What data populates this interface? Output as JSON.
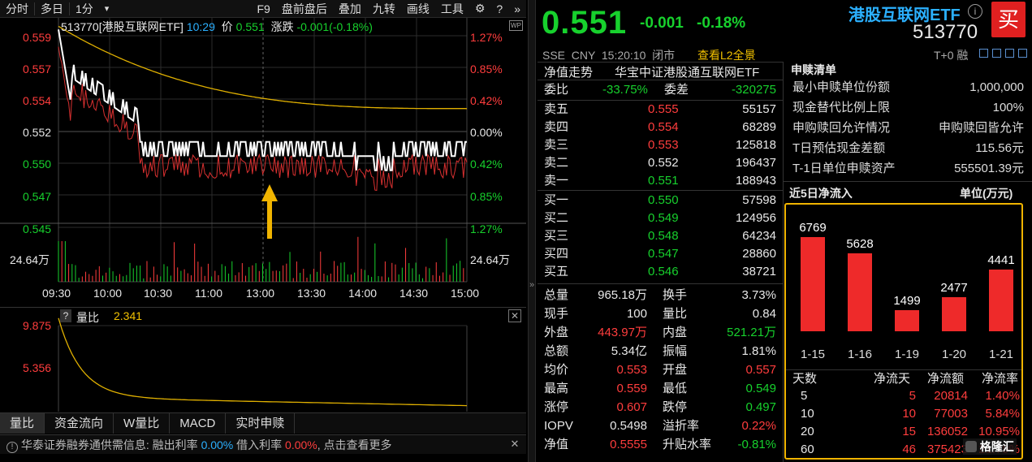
{
  "toolbar": {
    "items": [
      "分时",
      "多日",
      "1分",
      "▾",
      "F9",
      "盘前盘后",
      "叠加",
      "九转",
      "画线",
      "工具"
    ]
  },
  "chart": {
    "header_code": "513770[港股互联网ETF]",
    "header_time": "10:29",
    "header_price_label": "价",
    "header_price": "0.551",
    "header_change_label": "涨跌",
    "header_change": "-0.001(-0.18%)",
    "y_left": [
      "0.559",
      "0.557",
      "0.554",
      "0.552",
      "0.550",
      "0.547",
      "0.545"
    ],
    "y_right": [
      "1.27%",
      "0.85%",
      "0.42%",
      "0.00%",
      "0.42%",
      "0.85%",
      "1.27%"
    ],
    "vol_left": "24.64万",
    "vol_right": "24.64万",
    "x_labels": [
      "09:30",
      "10:00",
      "10:30",
      "11:00",
      "13:00",
      "13:30",
      "14:00",
      "14:30",
      "15:00"
    ],
    "colors": {
      "price": "#ffffff",
      "avg": "#e0b000",
      "nav": "#e03a3a",
      "up": "#ff3d3d",
      "down": "#17d12d"
    }
  },
  "volratio": {
    "title": "量比",
    "value": "2.341",
    "y_labels": [
      "9.875",
      "5.356"
    ]
  },
  "bottom_tabs": [
    "量比",
    "资金流向",
    "W量比",
    "MACD",
    "实时申赎"
  ],
  "ticker_bar": {
    "prefix": "华泰证券融券通供需信息:",
    "l1": "融出利率",
    "v1": "0.00%",
    "l2": "借入利率",
    "v2": "0.00%",
    "suffix": "点击查看更多"
  },
  "quote": {
    "price": "0.551",
    "change": "-0.001",
    "change_pct": "-0.18%",
    "name": "港股互联网ETF",
    "code": "513770",
    "buy_button": "买",
    "meta": "SSE  CNY  15:20:10  闭市",
    "l2_link": "查看L2全景",
    "t0": "T+0 融",
    "nav_trend": "净值走势",
    "index_name": "华宝中证港股通互联网ETF",
    "weibi_label": "委比",
    "weibi": "-33.75%",
    "weicha_label": "委差",
    "weicha": "-320275"
  },
  "order_book": {
    "asks": [
      {
        "label": "卖五",
        "price": "0.555",
        "vol": "55157",
        "color": "red"
      },
      {
        "label": "卖四",
        "price": "0.554",
        "vol": "68289",
        "color": "red"
      },
      {
        "label": "卖三",
        "price": "0.553",
        "vol": "125818",
        "color": "red"
      },
      {
        "label": "卖二",
        "price": "0.552",
        "vol": "196437",
        "color": "white"
      },
      {
        "label": "卖一",
        "price": "0.551",
        "vol": "188943",
        "color": "green"
      }
    ],
    "bids": [
      {
        "label": "买一",
        "price": "0.550",
        "vol": "57598",
        "color": "green"
      },
      {
        "label": "买二",
        "price": "0.549",
        "vol": "124956",
        "color": "green"
      },
      {
        "label": "买三",
        "price": "0.548",
        "vol": "64234",
        "color": "green"
      },
      {
        "label": "买四",
        "price": "0.547",
        "vol": "28860",
        "color": "green"
      },
      {
        "label": "买五",
        "price": "0.546",
        "vol": "38721",
        "color": "green"
      }
    ]
  },
  "stats": [
    {
      "l1": "总量",
      "v1": "965.18万",
      "c1": "white",
      "l2": "换手",
      "v2": "3.73%",
      "c2": "white"
    },
    {
      "l1": "现手",
      "v1": "100",
      "c1": "white",
      "l2": "量比",
      "v2": "0.84",
      "c2": "white"
    },
    {
      "l1": "外盘",
      "v1": "443.97万",
      "c1": "red",
      "l2": "内盘",
      "v2": "521.21万",
      "c2": "green"
    },
    {
      "l1": "总额",
      "v1": "5.34亿",
      "c1": "white",
      "l2": "振幅",
      "v2": "1.81%",
      "c2": "white"
    },
    {
      "l1": "均价",
      "v1": "0.553",
      "c1": "red",
      "l2": "开盘",
      "v2": "0.557",
      "c2": "red"
    },
    {
      "l1": "最高",
      "v1": "0.559",
      "c1": "red",
      "l2": "最低",
      "v2": "0.549",
      "c2": "green"
    },
    {
      "l1": "涨停",
      "v1": "0.607",
      "c1": "red",
      "l2": "跌停",
      "v2": "0.497",
      "c2": "green"
    },
    {
      "l1": "IOPV",
      "v1": "0.5498",
      "c1": "white",
      "l2": "溢折率",
      "v2": "0.22%",
      "c2": "red"
    },
    {
      "l1": "净值",
      "v1": "0.5555",
      "c1": "red",
      "l2": "升贴水率",
      "v2": "-0.81%",
      "c2": "green"
    }
  ],
  "creation": {
    "title": "申赎清单",
    "rows": [
      {
        "k": "最小申赎单位份额",
        "v": "1,000,000"
      },
      {
        "k": "现金替代比例上限",
        "v": "100%"
      },
      {
        "k": "申购赎回允许情况",
        "v": "申购赎回皆允许"
      },
      {
        "k": "T日预估现金差额",
        "v": "115.56元"
      },
      {
        "k": "T-1日单位申赎资产",
        "v": "555501.39元"
      }
    ]
  },
  "flow": {
    "title": "近5日净流入",
    "unit": "单位(万元)",
    "headers": [
      "天数",
      "净流天",
      "净流额",
      "净流率"
    ],
    "rows": [
      {
        "d": "5",
        "n": "5",
        "amt": "20814",
        "rate": "1.40%"
      },
      {
        "d": "10",
        "n": "10",
        "amt": "77003",
        "rate": "5.84%"
      },
      {
        "d": "20",
        "n": "15",
        "amt": "136052",
        "rate": "10.95%"
      },
      {
        "d": "60",
        "n": "46",
        "amt": "375423",
        "rate": "21.79%"
      }
    ],
    "watermark": "格隆汇"
  },
  "chart_data": {
    "type": "bar",
    "categories": [
      "1-15",
      "1-16",
      "1-19",
      "1-20",
      "1-21"
    ],
    "values": [
      6769,
      5628,
      1499,
      2477,
      4441
    ],
    "ylim": [
      0,
      7500
    ],
    "xlabel": "",
    "ylabel": ""
  }
}
